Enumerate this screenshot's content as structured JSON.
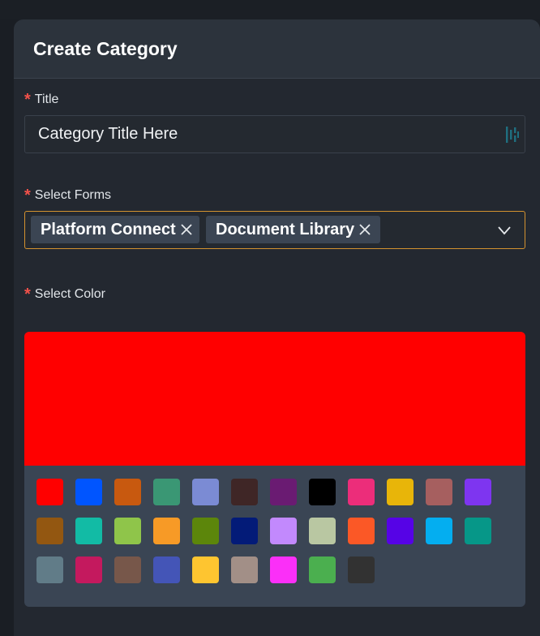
{
  "modal": {
    "title": "Create Category"
  },
  "fields": {
    "title": {
      "label": "Title",
      "required_mark": "*",
      "value": "Category Title Here"
    },
    "forms": {
      "label": "Select Forms",
      "required_mark": "*",
      "selected": [
        "Platform Connect",
        "Document Library"
      ]
    },
    "color": {
      "label": "Select Color",
      "required_mark": "*"
    }
  },
  "color_picker": {
    "selected": "#ff0000",
    "swatches": [
      "#ff0000",
      "#0055ff",
      "#c8590f",
      "#3a9774",
      "#7b8bd4",
      "#3f2626",
      "#6a1b72",
      "#000000",
      "#ec2d7a",
      "#e8b509",
      "#a65f5f",
      "#7e35f0",
      "#935711",
      "#12bba5",
      "#8fc54a",
      "#f79a26",
      "#5c860b",
      "#031b78",
      "#c289fd",
      "#b9c7a2",
      "#fb5826",
      "#5603e6",
      "#04aef0",
      "#069788",
      "#617c88",
      "#c4195e",
      "#77574a",
      "#4455b7",
      "#fec530",
      "#a28f87",
      "#fb2ff8",
      "#4baf4f",
      "#323232"
    ]
  }
}
